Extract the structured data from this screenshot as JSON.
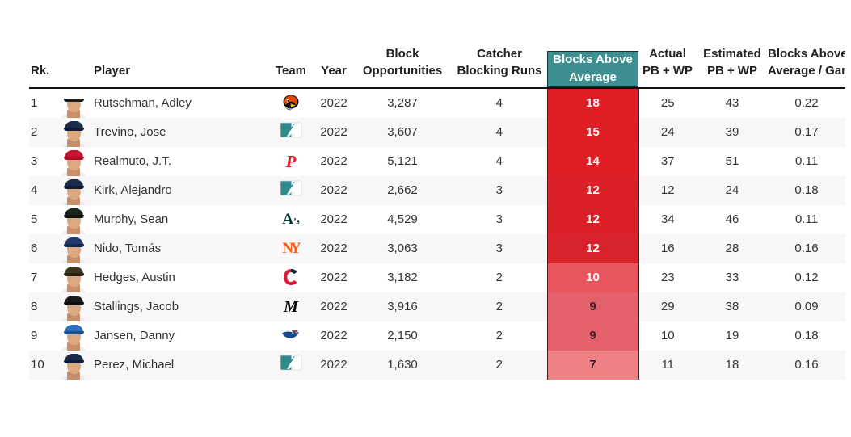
{
  "table": {
    "columns": [
      {
        "key": "rank",
        "label": "Rk.",
        "label2": ""
      },
      {
        "key": "player",
        "label": "Player",
        "label2": ""
      },
      {
        "key": "team",
        "label": "Team",
        "label2": ""
      },
      {
        "key": "year",
        "label": "Year",
        "label2": ""
      },
      {
        "key": "block_opportunities",
        "label": "Block",
        "label2": "Opportunities"
      },
      {
        "key": "catcher_blocking_runs",
        "label": "Catcher",
        "label2": "Blocking Runs"
      },
      {
        "key": "blocks_above_average",
        "label": "Blocks Above",
        "label2": "Average"
      },
      {
        "key": "actual_pb_wp",
        "label": "Actual",
        "label2": "PB + WP"
      },
      {
        "key": "estimated_pb_wp",
        "label": "Estimated",
        "label2": "PB + WP"
      },
      {
        "key": "blocks_above_average_per_game",
        "label": "Blocks Above",
        "label2": "Average / Game"
      }
    ],
    "highlighted_column": "blocks_above_average",
    "highlight_color": "#3d8f91",
    "rows": [
      {
        "rank": "1",
        "player": "Rutschman, Adley",
        "team": "BAL",
        "year": "2022",
        "block_opportunities": "3,287",
        "catcher_blocking_runs": "4",
        "blocks_above_average": "18",
        "actual_pb_wp": "25",
        "estimated_pb_wp": "43",
        "blocks_above_average_per_game": "0.22",
        "heat_color": "#e01e26",
        "heat_text": "#ffffff"
      },
      {
        "rank": "2",
        "player": "Trevino, Jose",
        "team": "MLB",
        "year": "2022",
        "block_opportunities": "3,607",
        "catcher_blocking_runs": "4",
        "blocks_above_average": "15",
        "actual_pb_wp": "24",
        "estimated_pb_wp": "39",
        "blocks_above_average_per_game": "0.17",
        "heat_color": "#e01e26",
        "heat_text": "#ffffff"
      },
      {
        "rank": "3",
        "player": "Realmuto, J.T.",
        "team": "PHI",
        "year": "2022",
        "block_opportunities": "5,121",
        "catcher_blocking_runs": "4",
        "blocks_above_average": "14",
        "actual_pb_wp": "37",
        "estimated_pb_wp": "51",
        "blocks_above_average_per_game": "0.11",
        "heat_color": "#e01e26",
        "heat_text": "#ffffff"
      },
      {
        "rank": "4",
        "player": "Kirk, Alejandro",
        "team": "MLB",
        "year": "2022",
        "block_opportunities": "2,662",
        "catcher_blocking_runs": "3",
        "blocks_above_average": "12",
        "actual_pb_wp": "12",
        "estimated_pb_wp": "24",
        "blocks_above_average_per_game": "0.18",
        "heat_color": "#dc2028",
        "heat_text": "#ffffff"
      },
      {
        "rank": "5",
        "player": "Murphy, Sean",
        "team": "OAK",
        "year": "2022",
        "block_opportunities": "4,529",
        "catcher_blocking_runs": "3",
        "blocks_above_average": "12",
        "actual_pb_wp": "34",
        "estimated_pb_wp": "46",
        "blocks_above_average_per_game": "0.11",
        "heat_color": "#dc2028",
        "heat_text": "#ffffff"
      },
      {
        "rank": "6",
        "player": "Nido, Tomás",
        "team": "NYM",
        "year": "2022",
        "block_opportunities": "3,063",
        "catcher_blocking_runs": "3",
        "blocks_above_average": "12",
        "actual_pb_wp": "16",
        "estimated_pb_wp": "28",
        "blocks_above_average_per_game": "0.16",
        "heat_color": "#d9232c",
        "heat_text": "#ffffff"
      },
      {
        "rank": "7",
        "player": "Hedges, Austin",
        "team": "CLE",
        "year": "2022",
        "block_opportunities": "3,182",
        "catcher_blocking_runs": "2",
        "blocks_above_average": "10",
        "actual_pb_wp": "23",
        "estimated_pb_wp": "33",
        "blocks_above_average_per_game": "0.12",
        "heat_color": "#e8555c",
        "heat_text": "#ffffff"
      },
      {
        "rank": "8",
        "player": "Stallings, Jacob",
        "team": "MIA",
        "year": "2022",
        "block_opportunities": "3,916",
        "catcher_blocking_runs": "2",
        "blocks_above_average": "9",
        "actual_pb_wp": "29",
        "estimated_pb_wp": "38",
        "blocks_above_average_per_game": "0.09",
        "heat_color": "#e4606a",
        "heat_text": "#3a2225"
      },
      {
        "rank": "9",
        "player": "Jansen, Danny",
        "team": "TOR",
        "year": "2022",
        "block_opportunities": "2,150",
        "catcher_blocking_runs": "2",
        "blocks_above_average": "9",
        "actual_pb_wp": "10",
        "estimated_pb_wp": "19",
        "blocks_above_average_per_game": "0.18",
        "heat_color": "#e4606a",
        "heat_text": "#3a2225"
      },
      {
        "rank": "10",
        "player": "Perez, Michael",
        "team": "MLB",
        "year": "2022",
        "block_opportunities": "1,630",
        "catcher_blocking_runs": "2",
        "blocks_above_average": "7",
        "actual_pb_wp": "11",
        "estimated_pb_wp": "18",
        "blocks_above_average_per_game": "0.16",
        "heat_color": "#ee8086",
        "heat_text": "#3a2225"
      }
    ]
  },
  "teams": {
    "BAL": {
      "name": "Orioles",
      "primary": "#df4601",
      "secondary": "#000000"
    },
    "MLB": {
      "name": "MLB",
      "primary": "#2f8a8c",
      "secondary": "#ffffff"
    },
    "PHI": {
      "name": "Phillies",
      "primary": "#e81828",
      "secondary": "#ffffff"
    },
    "OAK": {
      "name": "Athletics",
      "primary": "#003831",
      "secondary": "#efb21e"
    },
    "NYM": {
      "name": "Mets",
      "primary": "#ff5910",
      "secondary": "#002d72"
    },
    "CLE": {
      "name": "Guardians",
      "primary": "#e31937",
      "secondary": "#0c2340"
    },
    "MIA": {
      "name": "Marlins",
      "primary": "#000000",
      "secondary": "#00a3e0"
    },
    "TOR": {
      "name": "Blue Jays",
      "primary": "#134a8e",
      "secondary": "#e8291c"
    }
  },
  "caps": {
    "BAL": {
      "crown": "#ffffff",
      "brim": "#1a1a1a"
    },
    "MLB": {
      "crown": "#1b2a4a",
      "brim": "#121c30"
    },
    "PHI": {
      "crown": "#c8102e",
      "brim": "#b00c26"
    },
    "OAK": {
      "crown": "#16221c",
      "brim": "#0d1512"
    },
    "NYM": {
      "crown": "#1f3a6e",
      "brim": "#15294d"
    },
    "CLE": {
      "crown": "#3d3520",
      "brim": "#2a2417"
    },
    "MIA": {
      "crown": "#1c1c1c",
      "brim": "#0f0f0f"
    },
    "TOR": {
      "crown": "#2f6fbf",
      "brim": "#1e4e8c"
    }
  }
}
